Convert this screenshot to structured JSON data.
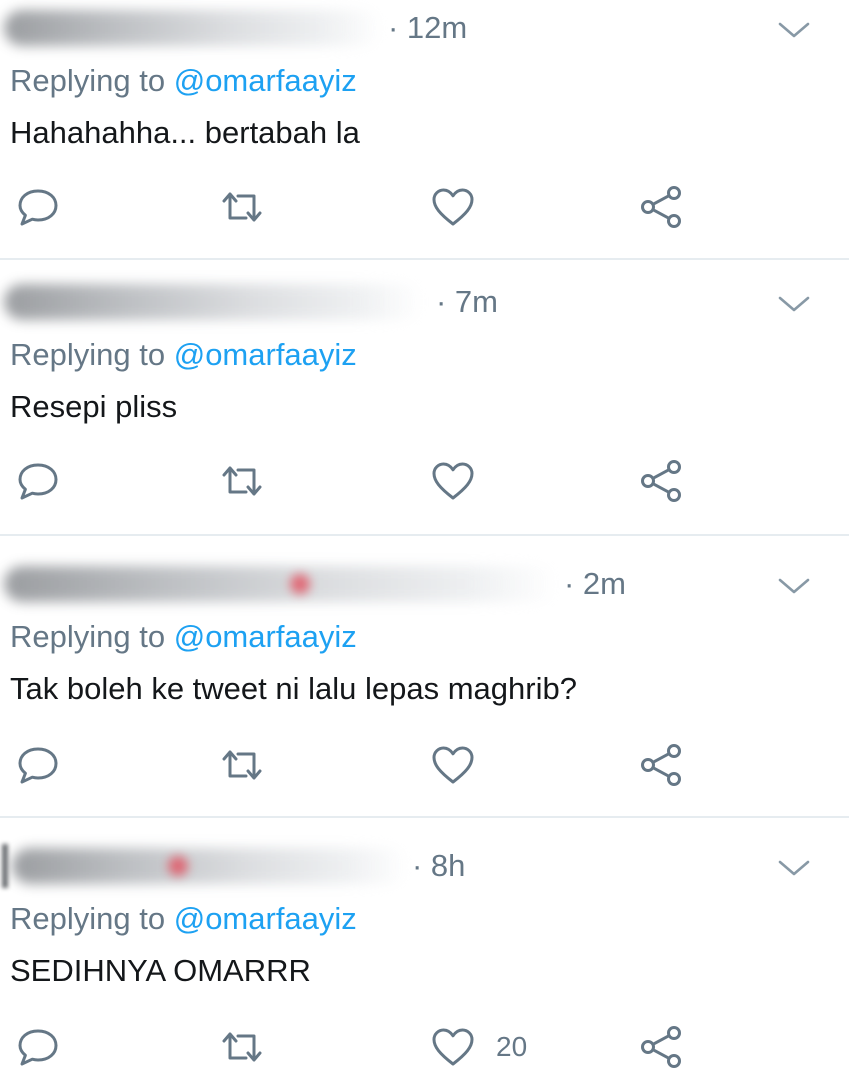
{
  "reply_prefix": "Replying to ",
  "tweets": [
    {
      "time": "· 12m",
      "mention": "@omarfaayiz",
      "text": "Hahahahha... bertabah la",
      "like_count": ""
    },
    {
      "time": "· 7m",
      "mention": "@omarfaayiz",
      "text": "Resepi pliss",
      "like_count": ""
    },
    {
      "time": "· 2m",
      "mention": "@omarfaayiz",
      "text": "Tak boleh ke tweet ni lalu lepas maghrib?",
      "like_count": ""
    },
    {
      "time": "· 8h",
      "mention": "@omarfaayiz",
      "text": "SEDIHNYA OMARRR",
      "like_count": "20"
    }
  ],
  "colors": {
    "text": "#14171a",
    "secondary": "#657786",
    "link": "#1da1f2",
    "icon": "#657786",
    "divider": "#e6ecf0"
  },
  "icons": [
    "reply-icon",
    "retweet-icon",
    "like-icon",
    "share-icon",
    "chevron-down-icon"
  ]
}
